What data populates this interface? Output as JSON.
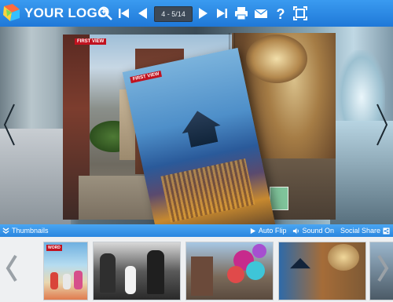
{
  "toolbar": {
    "logo_text": "YOUR LOGO",
    "page_indicator": "4 - 5/14",
    "buttons": [
      "zoom-in",
      "first-page",
      "previous-page",
      "next-page",
      "last-page",
      "print",
      "email",
      "help",
      "fullscreen"
    ]
  },
  "pages": {
    "left_tag": "FIRST VIEW",
    "flip_tag": "FIRST VIEW"
  },
  "thumbnail_bar": {
    "thumbnails_label": "Thumbnails",
    "auto_flip_label": "Auto Flip",
    "sound_label": "Sound On",
    "social_label": "Social Share"
  },
  "thumbnails": {
    "first_tag": "WORD"
  },
  "colors": {
    "toolbar": "#2c8ce6",
    "accent_red": "#c1121f",
    "strip_bg": "#eef0f2"
  }
}
